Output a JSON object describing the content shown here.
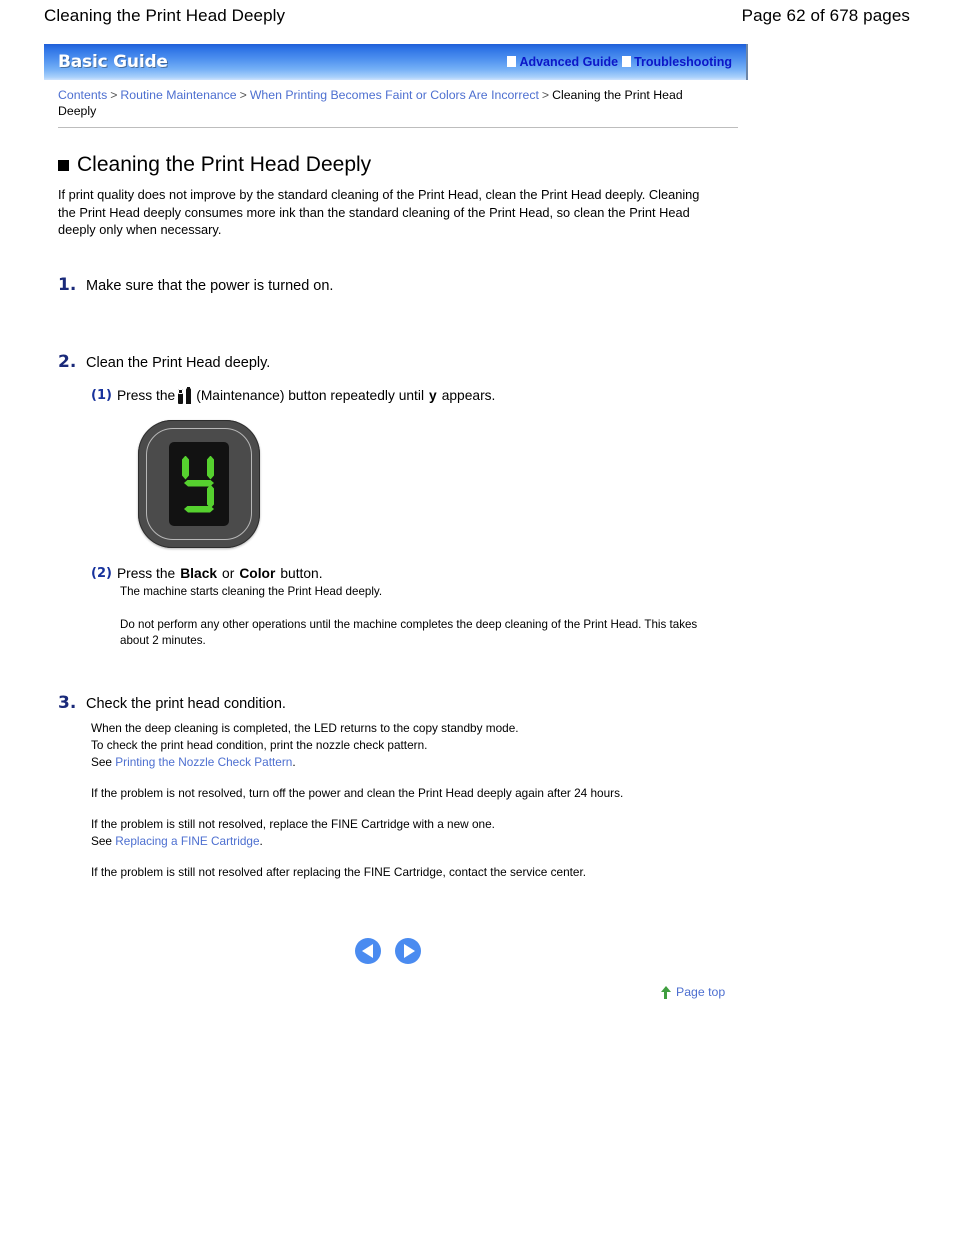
{
  "page_header": {
    "doc_title": "Cleaning the Print Head Deeply",
    "page_count": "Page 62 of 678 pages"
  },
  "guide_bar": {
    "brand": "Basic Guide",
    "links": [
      {
        "label": "Advanced Guide",
        "icon": "white-square-icon"
      },
      {
        "label": "Troubleshooting",
        "icon": "white-square-icon"
      }
    ]
  },
  "breadcrumb": {
    "items": [
      {
        "label": "Contents",
        "link": true
      },
      {
        "label": "Routine Maintenance",
        "link": true
      },
      {
        "label": "When Printing Becomes Faint or Colors Are Incorrect",
        "link": true
      },
      {
        "label": "Cleaning the Print Head Deeply",
        "link": false
      }
    ],
    "separator": ">"
  },
  "section": {
    "title": "Cleaning the Print Head Deeply",
    "intro": "If print quality does not improve by the standard cleaning of the Print Head, clean the Print Head deeply. Cleaning the Print Head deeply consumes more ink than the standard cleaning of the Print Head, so clean the Print Head deeply only when necessary."
  },
  "steps": [
    {
      "number": "1.",
      "text": "Make sure that the power is turned on."
    },
    {
      "number": "2.",
      "text": "Clean the Print Head deeply.",
      "substeps": [
        {
          "number": "(1)",
          "text_before": "Press the",
          "icon": "maintenance-icon",
          "text_mid": "(Maintenance) button repeatedly until",
          "code": "y",
          "text_after": "appears."
        },
        {
          "number": "(2)",
          "text_before": "Press the",
          "bold1": "Black",
          "text_mid": "or",
          "bold2": "Color",
          "text_after": "button.",
          "note1": "The machine starts cleaning the Print Head deeply.",
          "note2": "Do not perform any other operations until the machine completes the deep cleaning of the Print Head. This takes about 2 minutes."
        }
      ]
    },
    {
      "number": "3.",
      "text": "Check the print head condition.",
      "details": [
        "When the deep cleaning is completed, the LED returns to the copy standby mode.",
        "To check the print head condition, print the nozzle check pattern.",
        "If the problem is not resolved, turn off the power and clean the Print Head deeply again after 24 hours.",
        "If the problem is still not resolved, replace the FINE Cartridge with a new one.",
        "If the problem is still not resolved after replacing the FINE Cartridge, contact the service center."
      ],
      "see_label": "See",
      "see_link_1": "Printing the Nozzle Check Pattern",
      "see_link_2": "Replacing a FINE Cartridge",
      "period": "."
    }
  ],
  "led_display": {
    "name": "led-display-image",
    "character": "y",
    "segment_color": "#56d12f",
    "screen_color": "#121212",
    "body_color": "#4b4b4b"
  },
  "navigation": {
    "prev_label": "previous-page",
    "next_label": "next-page",
    "page_top_label": "Page top"
  },
  "colors": {
    "link_blue": "#4d6fd0",
    "bar_link_blue": "#0b16c8",
    "step_navy": "#1a2a7a",
    "substep_blue": "#17329c",
    "led_green": "#56d12f",
    "arrow_blue": "#4a8bf0",
    "page_top_green": "#3f9e3f"
  }
}
